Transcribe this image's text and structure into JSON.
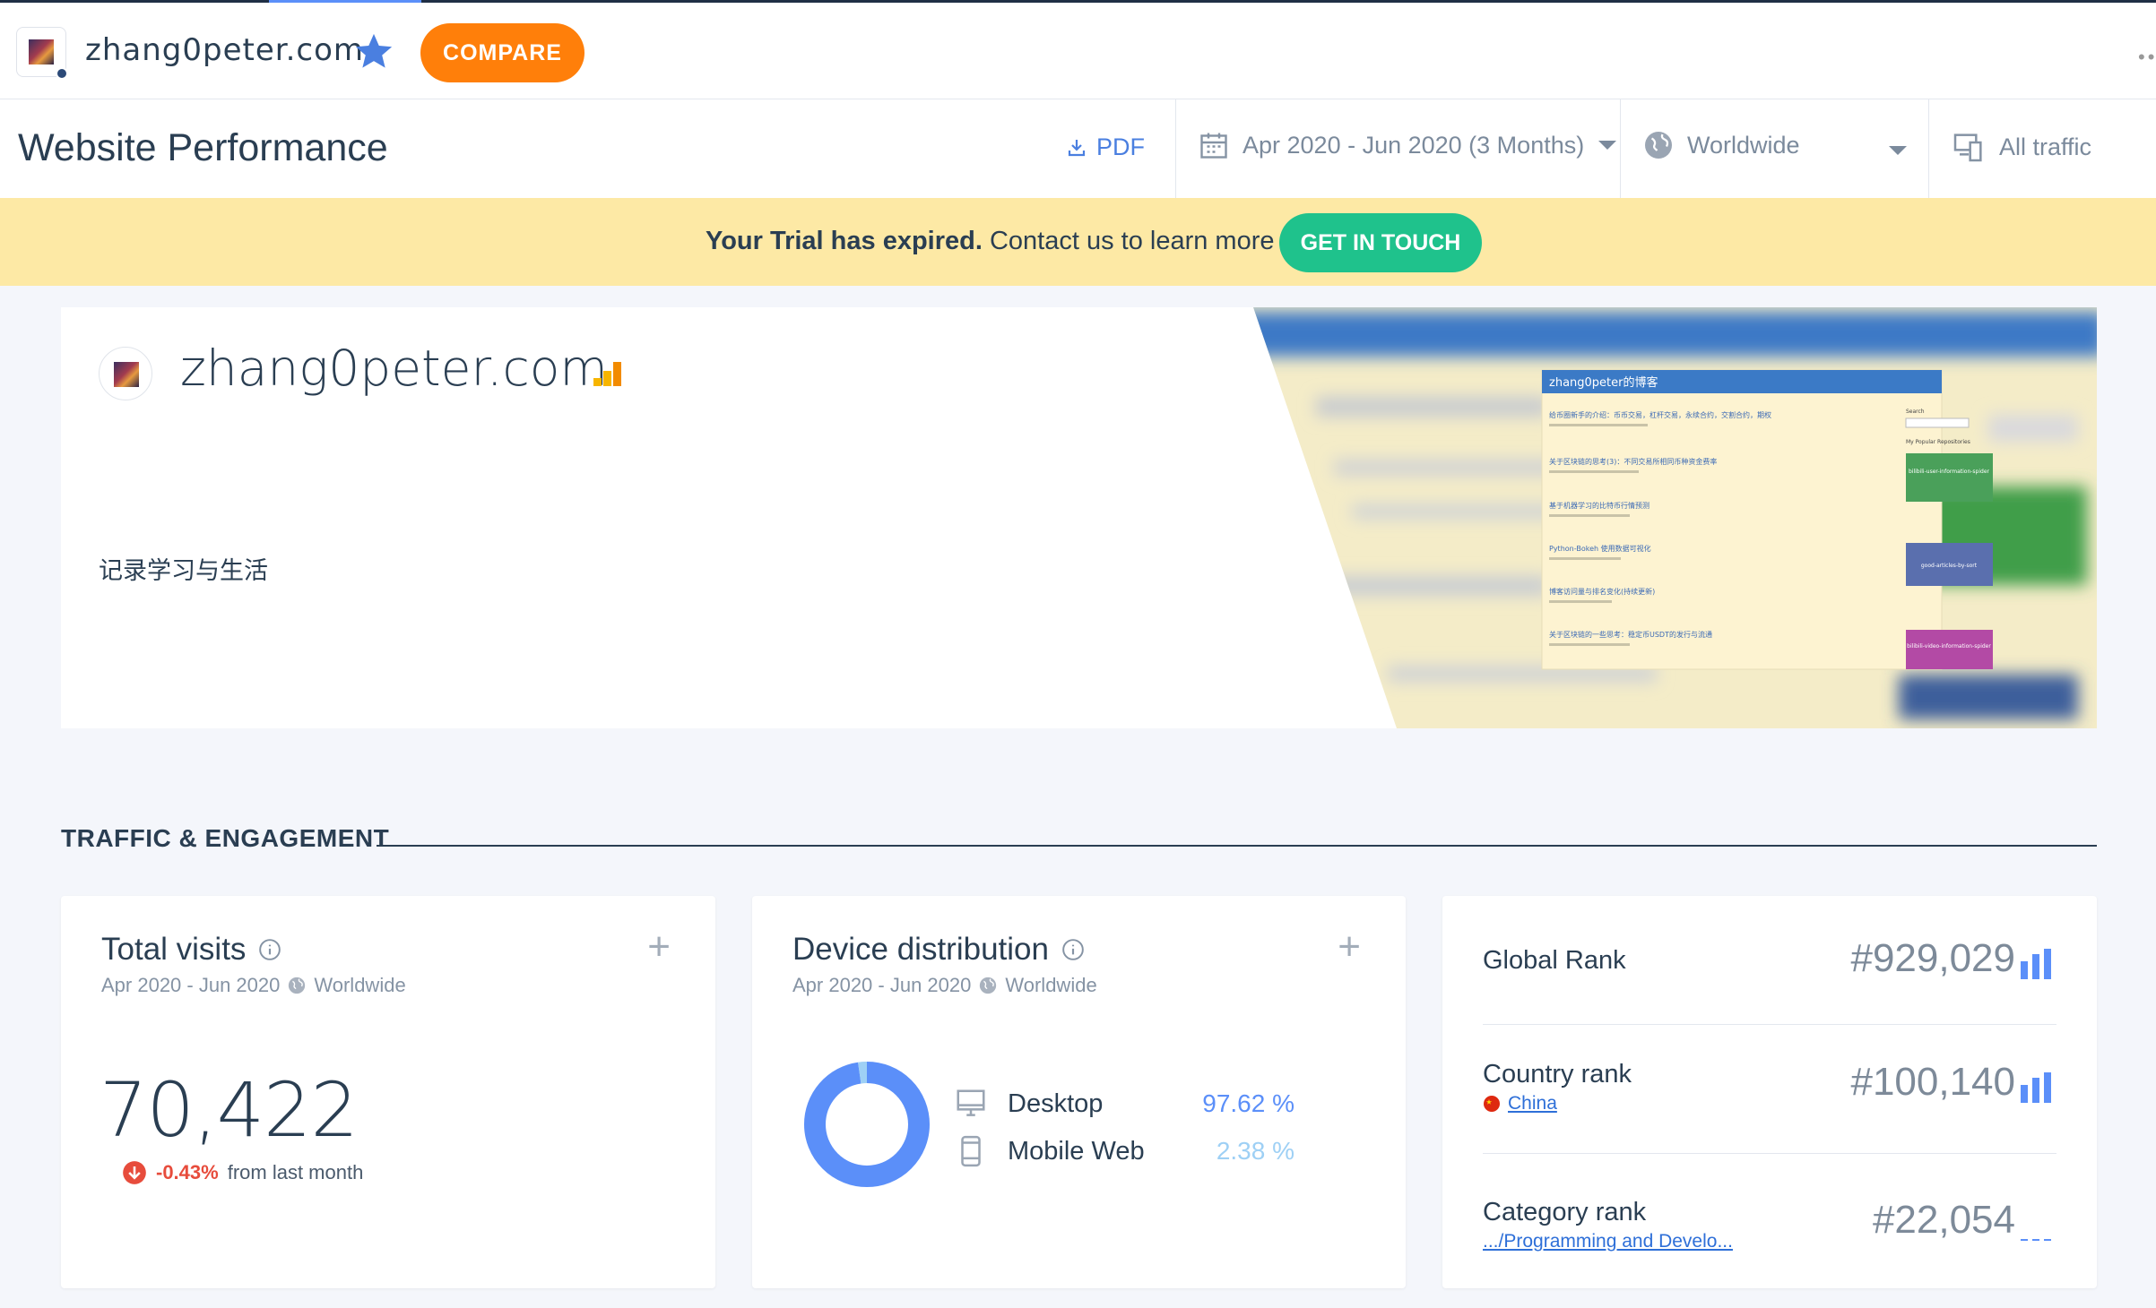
{
  "topbar": {
    "site_name": "zhang0peter.com",
    "compare_label": "COMPARE",
    "more_label": "••"
  },
  "perfbar": {
    "title": "Website Performance",
    "pdf_label": "PDF",
    "date_range": "Apr 2020 - Jun 2020 (3 Months)",
    "geo": "Worldwide",
    "traffic": "All traffic"
  },
  "trial": {
    "bold": "Your Trial has expired.",
    "rest": " Contact us to learn more",
    "button": "GET IN TOUCH"
  },
  "hero": {
    "site_name": "zhang0peter.com",
    "description": "记录学习与生活",
    "screenshot": {
      "blog_title": "zhang0peter的博客",
      "posts": [
        "给币圈新手的介绍：币币交易，杠杆交易，永续合约，交割合约，期权",
        "关于区块链的思考(3)：不同交易所相同币种资金费率",
        "基于机器学习的比特币行情预测",
        "Python-Bokeh 使用数据可视化",
        "博客访问量与排名变化(持续更新)",
        "关于区块链的一些思考：稳定币USDT的发行与流通"
      ],
      "search_label": "Search",
      "repos_label": "My Popular Repositories",
      "repos": [
        "bilibili-user-information-spider",
        "good-articles-by-sort",
        "bilibili-video-information-spider"
      ]
    }
  },
  "section": {
    "title": "TRAFFIC & ENGAGEMENT"
  },
  "visits": {
    "title": "Total visits",
    "period": "Apr 2020 - Jun 2020",
    "geo": "Worldwide",
    "value": "70,422",
    "change": "-0.43%",
    "change_suffix": "from last month"
  },
  "device": {
    "title": "Device distribution",
    "period": "Apr 2020 - Jun 2020",
    "geo": "Worldwide",
    "rows": [
      {
        "label": "Desktop",
        "value": "97.62 %",
        "share": 97.62,
        "color": "#5b8ff9"
      },
      {
        "label": "Mobile Web",
        "value": "2.38 %",
        "share": 2.38,
        "color": "#9ed0f5"
      }
    ]
  },
  "ranks": {
    "global": {
      "label": "Global Rank",
      "value": "#929,029"
    },
    "country": {
      "label": "Country rank",
      "link": "China",
      "value": "#100,140"
    },
    "category": {
      "label": "Category rank",
      "link": ".../Programming and Develo...",
      "value": "#22,054"
    }
  },
  "colors": {
    "accent_orange": "#ff7f0a",
    "accent_green": "#1fc28c",
    "accent_blue": "#5b8ff9",
    "banner": "#fde9a5",
    "negative": "#e74c3c"
  }
}
